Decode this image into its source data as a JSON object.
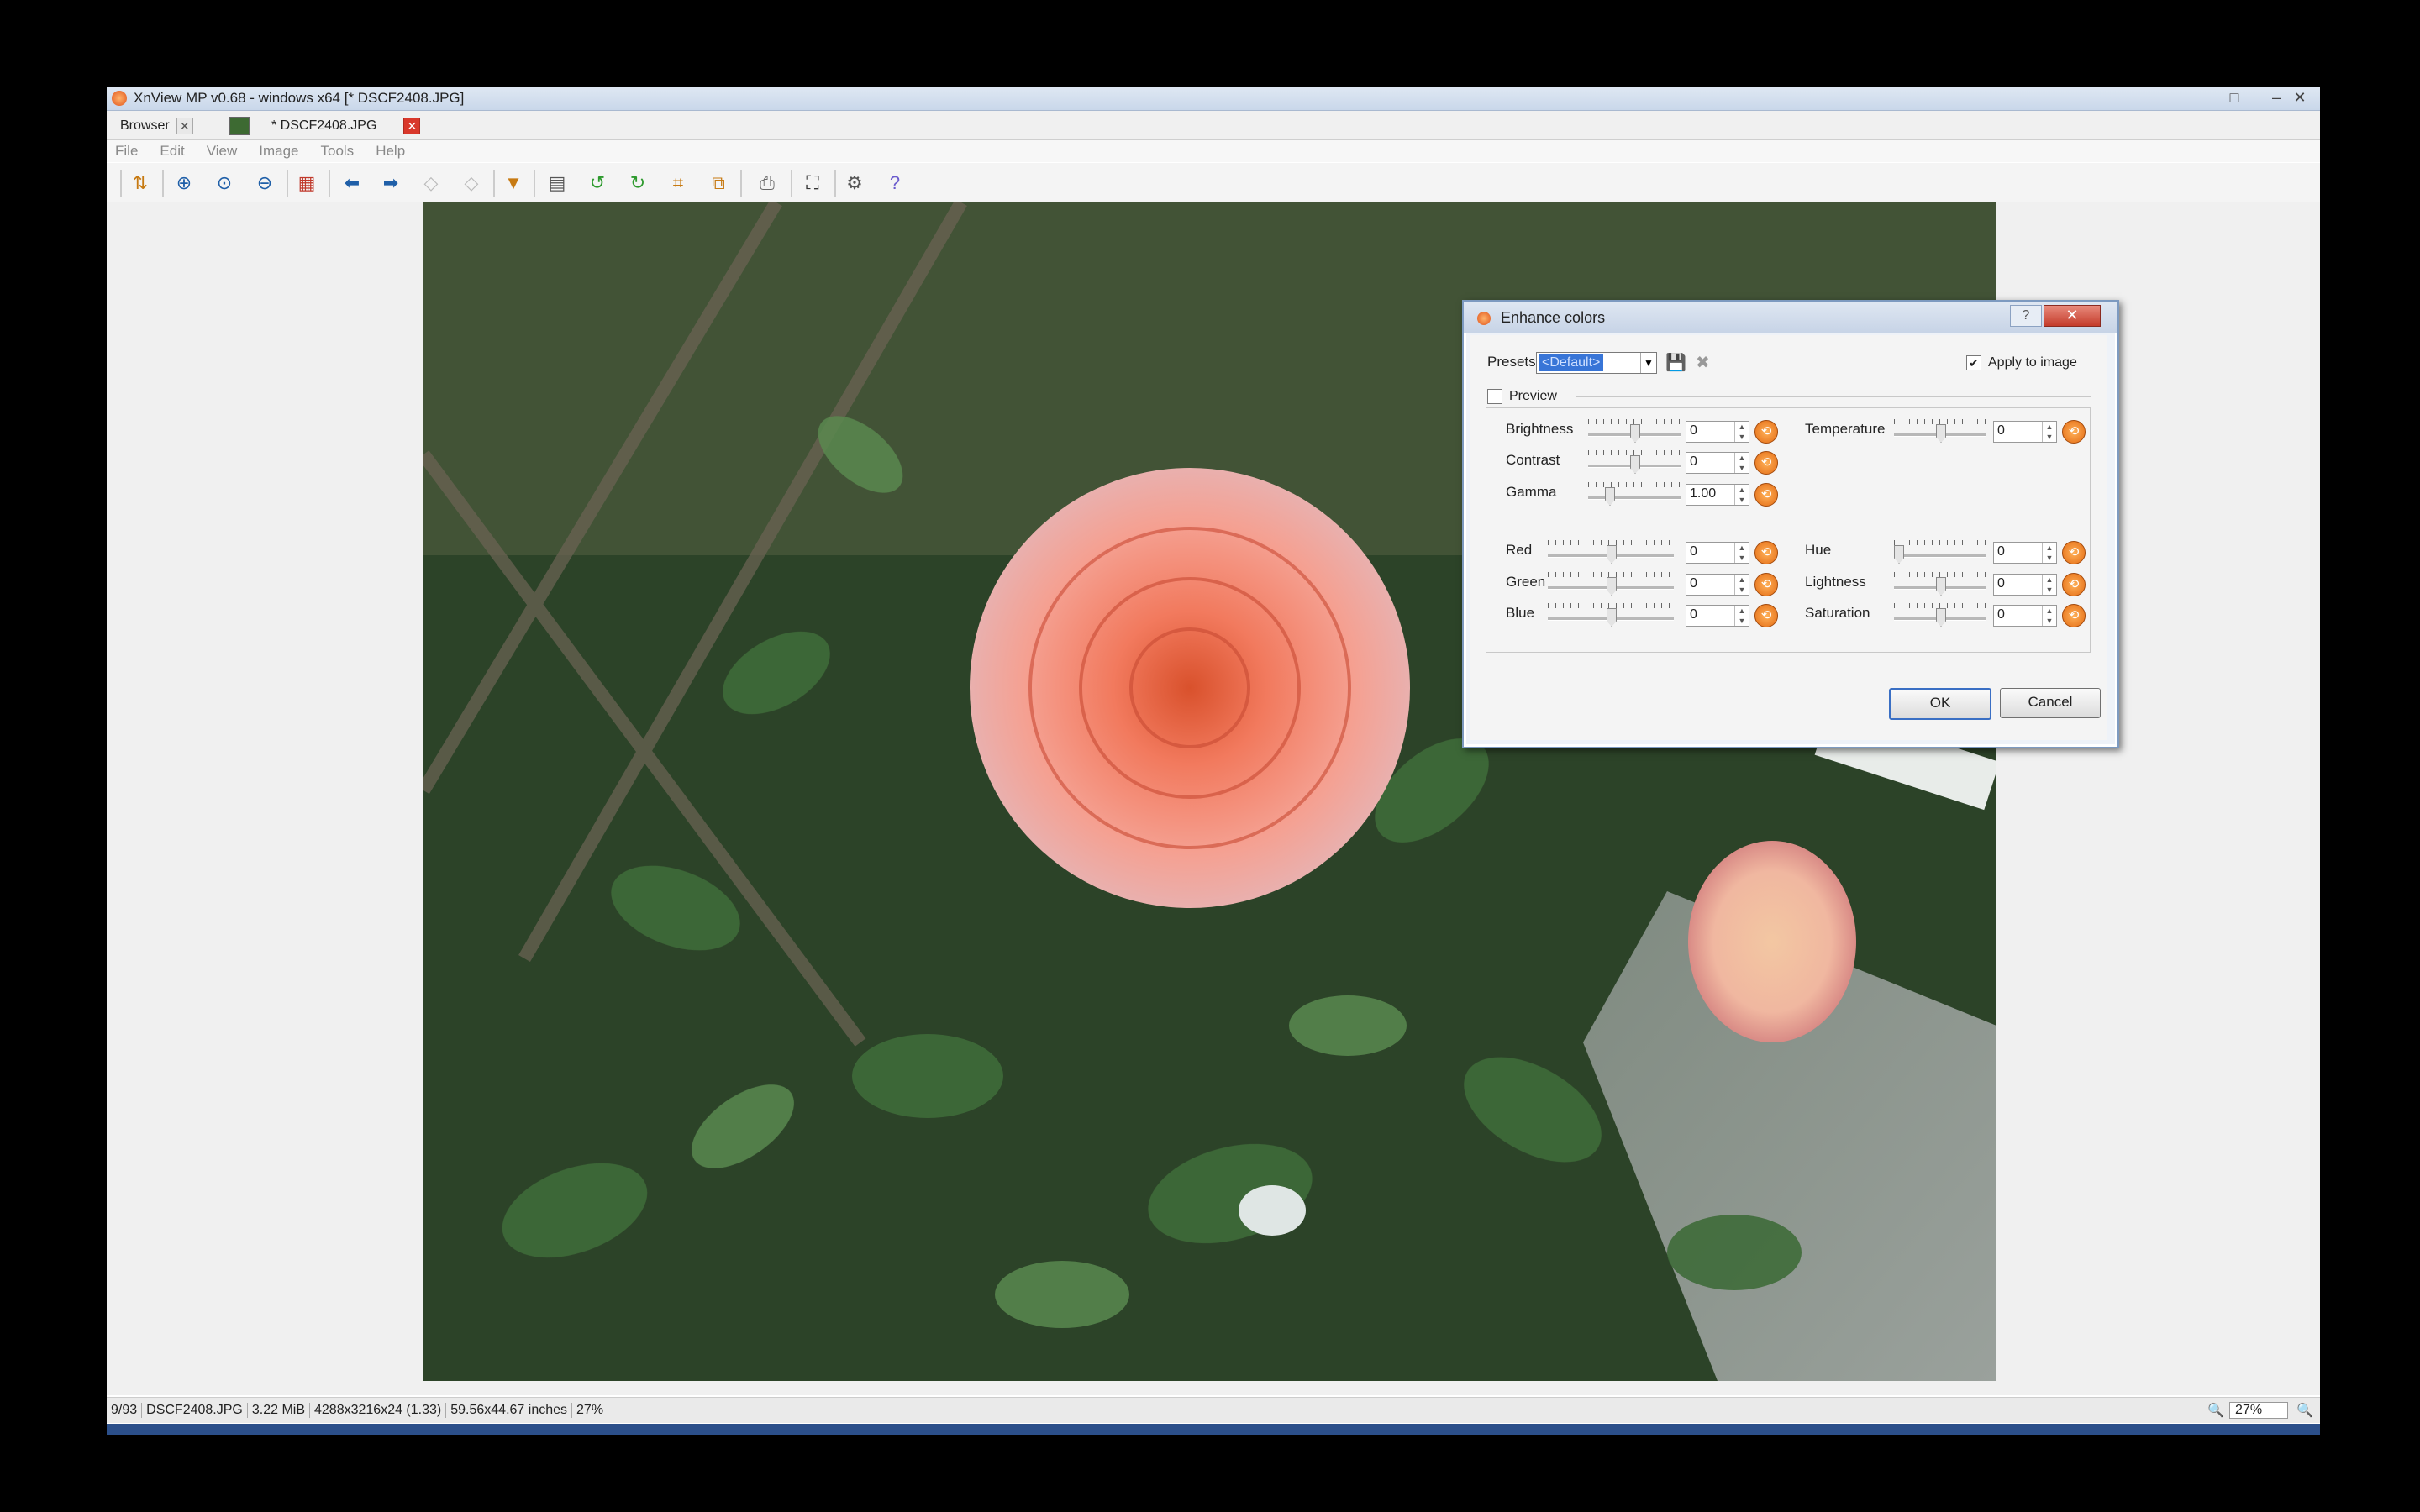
{
  "window": {
    "title": "XnView MP v0.68 - windows x64 [* DSCF2408.JPG]",
    "min_icon": "minimize-icon",
    "max_icon": "maximize-icon",
    "close_icon": "close-icon"
  },
  "tabs": [
    {
      "label": "Browser",
      "close": "✕"
    },
    {
      "label": "* DSCF2408.JPG",
      "close": "✕"
    }
  ],
  "menu": [
    "File",
    "Edit",
    "View",
    "Image",
    "Tools",
    "Help"
  ],
  "toolbar_icons": [
    "browser-toggle-icon",
    "zoom-in-icon",
    "zoom-fit-icon",
    "zoom-out-icon",
    "grid-icon",
    "previous-icon",
    "next-icon",
    "first-icon",
    "last-icon",
    "slideshow-icon",
    "filmstrip-icon",
    "rotate-left-icon",
    "rotate-right-icon",
    "crop-icon",
    "resize-icon",
    "print-icon",
    "fullscreen-icon",
    "settings-icon",
    "help-icon"
  ],
  "status": {
    "index": "9/93",
    "filename": "DSCF2408.JPG",
    "filesize": "3.22 MiB",
    "dimensions": "4288x3216x24 (1.33)",
    "print_size": "59.56x44.67 inches",
    "zoom": "27%",
    "zoom_field": "27%"
  },
  "dialog": {
    "title": "Enhance colors",
    "help": "?",
    "close": "✕",
    "presets_label": "Presets:",
    "preset_value": "<Default>",
    "apply_label": "Apply to image",
    "apply_checked": true,
    "preview_label": "Preview",
    "preview_checked": false,
    "sliders_left": [
      {
        "label": "Brightness",
        "value": "0",
        "level": 0.5
      },
      {
        "label": "Contrast",
        "value": "0",
        "level": 0.5
      },
      {
        "label": "Gamma",
        "value": "1.00",
        "level": 0.2
      },
      {
        "label": "Red",
        "value": "0",
        "level": 0.5
      },
      {
        "label": "Green",
        "value": "0",
        "level": 0.5
      },
      {
        "label": "Blue",
        "value": "0",
        "level": 0.5
      }
    ],
    "sliders_right": [
      {
        "label": "Temperature",
        "value": "0",
        "level": 0.5
      },
      {
        "label": "Hue",
        "value": "0",
        "level": 0.0
      },
      {
        "label": "Lightness",
        "value": "0",
        "level": 0.5
      },
      {
        "label": "Saturation",
        "value": "0",
        "level": 0.5
      }
    ],
    "ok_label": "OK",
    "cancel_label": "Cancel"
  },
  "colors": {
    "accent": "#3875d7",
    "close_red": "#c43b2a",
    "reset_orange": "#e36a12"
  }
}
